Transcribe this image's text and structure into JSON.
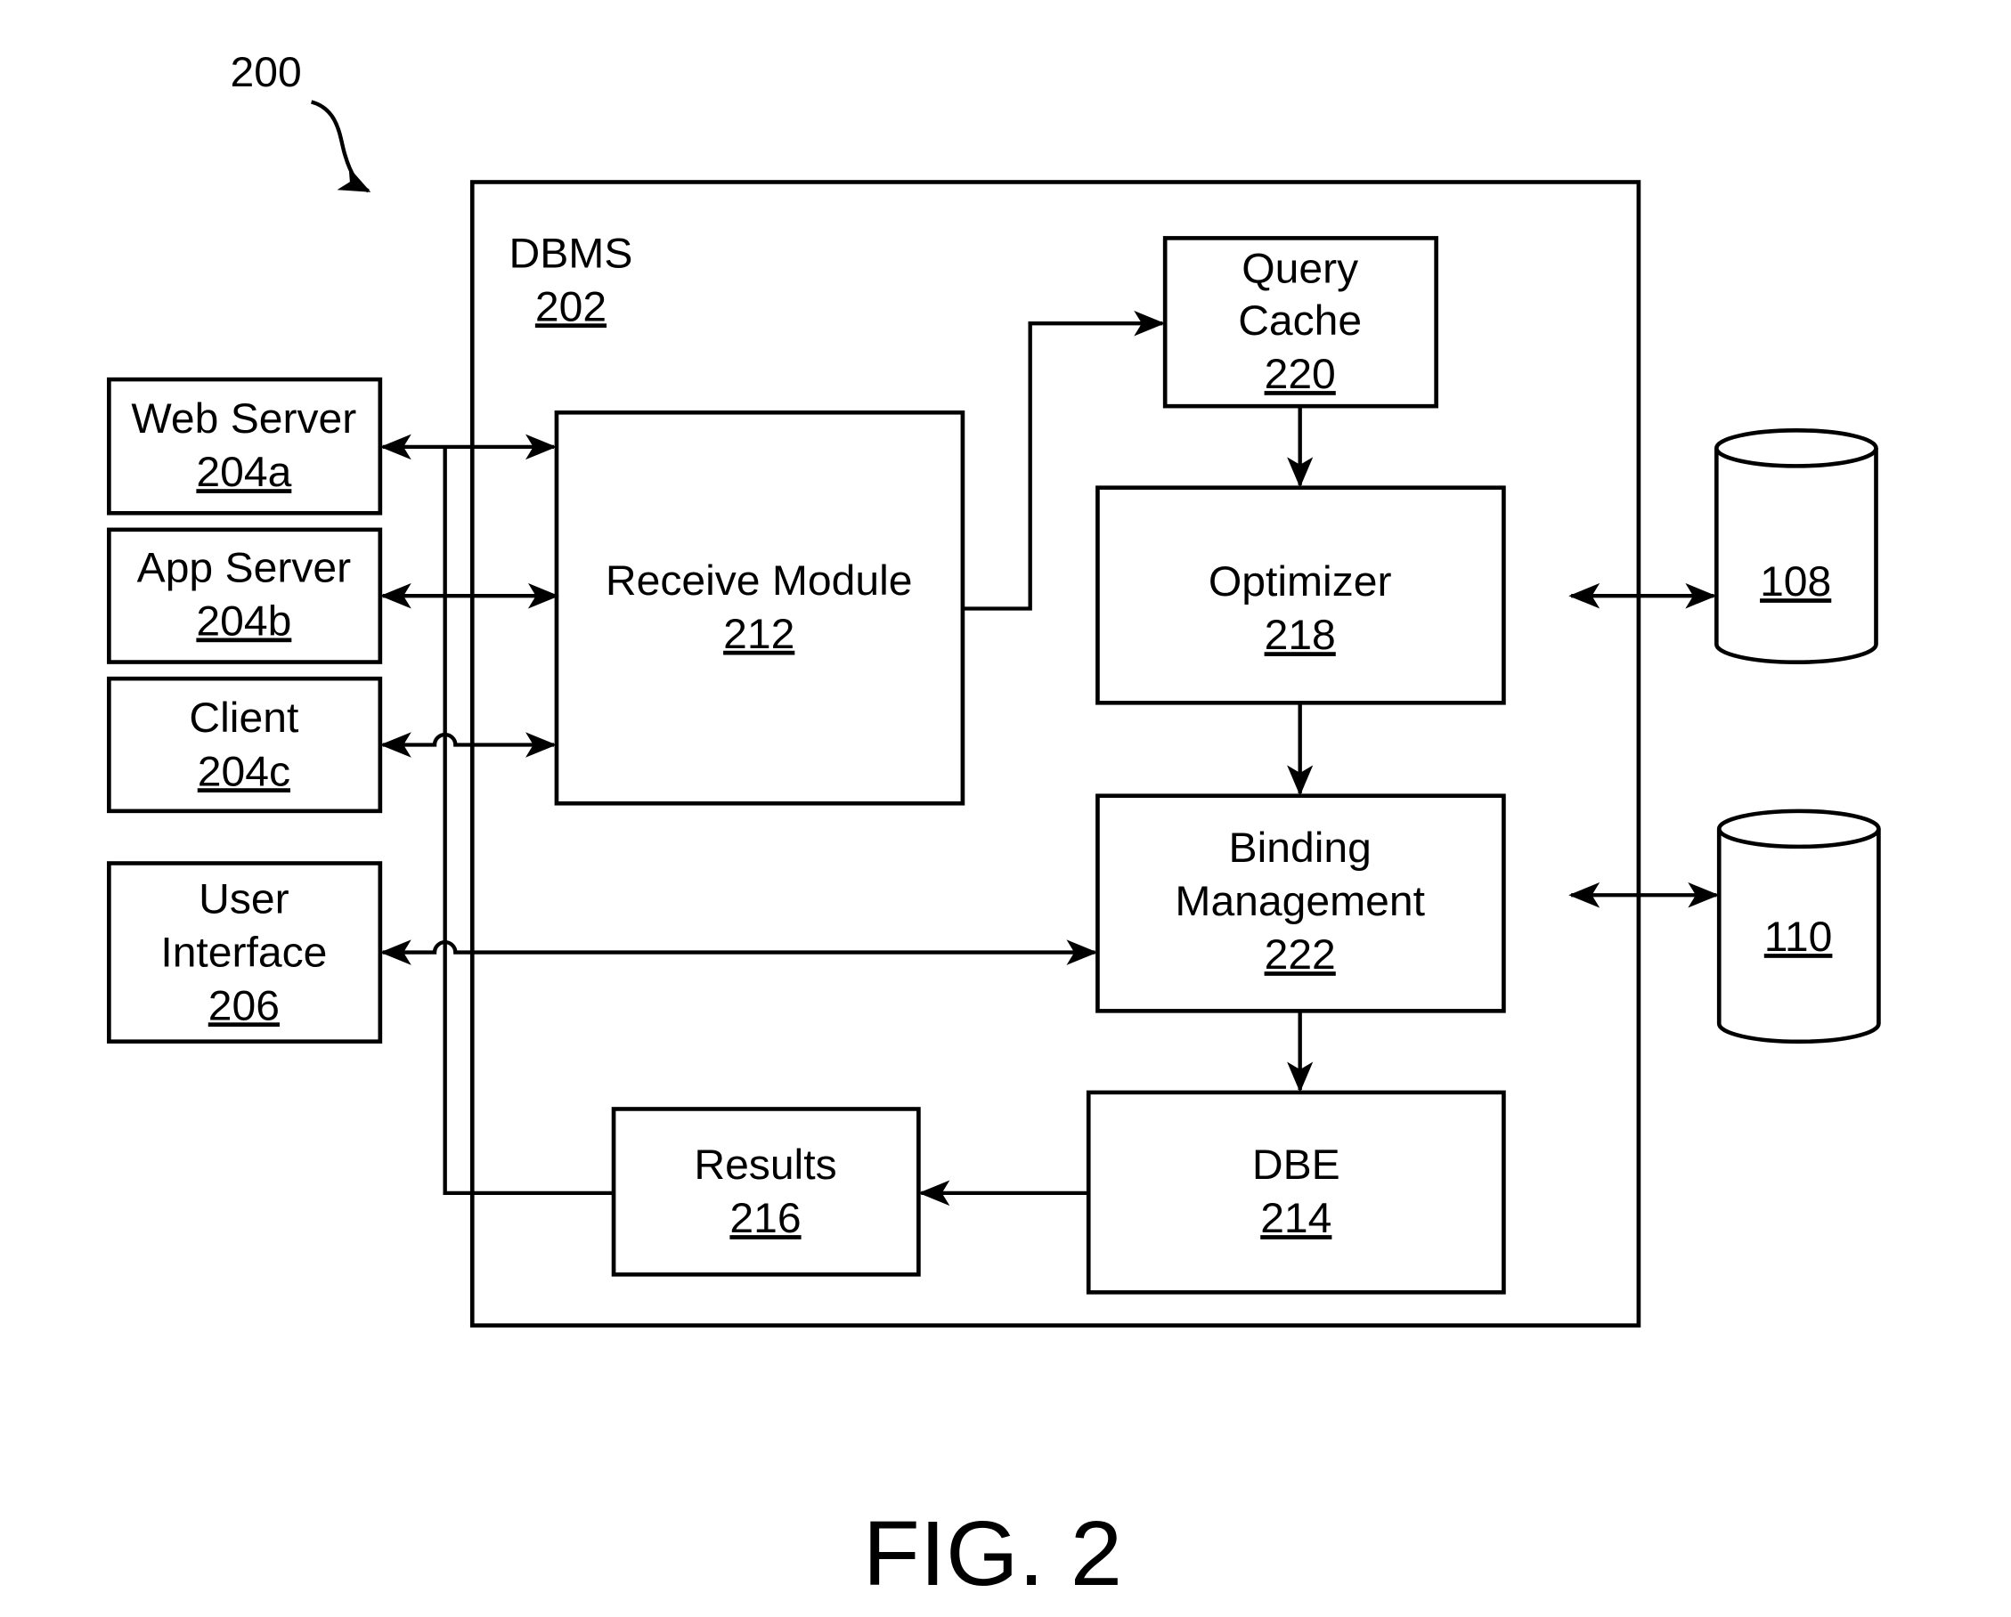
{
  "figure": {
    "reference_number": "200",
    "caption": "FIG. 2"
  },
  "dbms": {
    "label": "DBMS",
    "number": "202"
  },
  "external": {
    "web_server": {
      "label": "Web Server",
      "number": "204a"
    },
    "app_server": {
      "label": "App Server",
      "number": "204b"
    },
    "client": {
      "label": "Client",
      "number": "204c"
    },
    "user_interface": {
      "label1": "User",
      "label2": "Interface",
      "number": "206"
    }
  },
  "modules": {
    "receive_module": {
      "label": "Receive Module",
      "number": "212"
    },
    "query_cache": {
      "label1": "Query",
      "label2": "Cache",
      "number": "220"
    },
    "optimizer": {
      "label": "Optimizer",
      "number": "218"
    },
    "binding_management": {
      "label1": "Binding",
      "label2": "Management",
      "number": "222"
    },
    "dbe": {
      "label": "DBE",
      "number": "214"
    },
    "results": {
      "label": "Results",
      "number": "216"
    }
  },
  "storage": {
    "db1": {
      "number": "108"
    },
    "db2": {
      "number": "110"
    }
  },
  "connections": [
    {
      "from": "Web Server 204a",
      "to": "Receive Module 212",
      "direction": "bidirectional"
    },
    {
      "from": "App Server 204b",
      "to": "Receive Module 212",
      "direction": "bidirectional"
    },
    {
      "from": "Client 204c",
      "to": "Receive Module 212",
      "direction": "bidirectional"
    },
    {
      "from": "User Interface 206",
      "to": "Binding Management 222",
      "direction": "bidirectional"
    },
    {
      "from": "Receive Module 212",
      "to": "Query Cache 220",
      "direction": "forward"
    },
    {
      "from": "Query Cache 220",
      "to": "Optimizer 218",
      "direction": "forward"
    },
    {
      "from": "Optimizer 218",
      "to": "Binding Management 222",
      "direction": "forward"
    },
    {
      "from": "Binding Management 222",
      "to": "DBE 214",
      "direction": "forward"
    },
    {
      "from": "DBE 214",
      "to": "Results 216",
      "direction": "forward"
    },
    {
      "from": "Results 216",
      "to": "Web Server / App Server / Client bus",
      "direction": "forward"
    },
    {
      "from": "DBMS 202",
      "to": "108",
      "direction": "bidirectional"
    },
    {
      "from": "DBMS 202",
      "to": "110",
      "direction": "bidirectional"
    }
  ]
}
